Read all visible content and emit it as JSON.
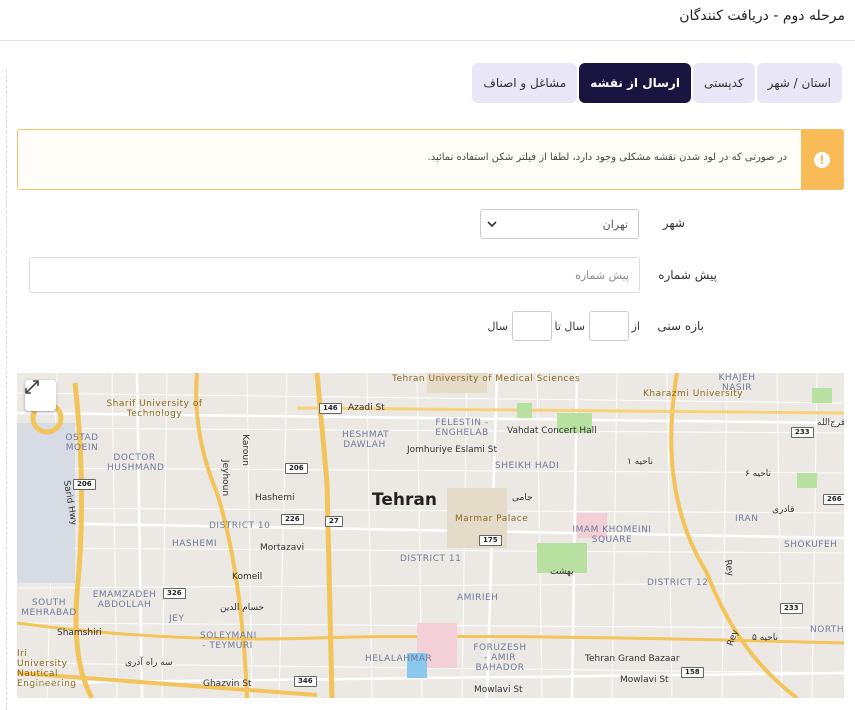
{
  "page": {
    "title": "مرحله دوم - دریافت کنندگان"
  },
  "tabs": [
    {
      "label": "استان / شهر",
      "active": false
    },
    {
      "label": "کدپستی",
      "active": false
    },
    {
      "label": "ارسال از نقشه",
      "active": true
    },
    {
      "label": "مشاغل و اصناف",
      "active": false
    }
  ],
  "alert": {
    "icon": "exclamation-icon",
    "text": "در صورتی که در لود شدن نقشه مشکلی وجود دارد، لطفا از فیلتر شکن استفاده نمائید."
  },
  "form": {
    "city_label": "شهر",
    "city_value": "تهران",
    "prefix_label": "پیش شماره",
    "prefix_placeholder": "پیش شماره",
    "age_label": "بازه سنی",
    "age_from": "از",
    "age_year_to": "سال تا",
    "age_year": "سال"
  },
  "map": {
    "city": "Tehran",
    "labels": {
      "l1": "Tehran University of Medical Sciences",
      "l2": "Sharif University of Technology",
      "l3": "Azadi St",
      "l4": "Kharazmi University",
      "l5": "KHAJEH NASIR",
      "l6": "OSTAD MOEIN",
      "l7": "HESHMAT DAWLAH",
      "l8": "FELESTIN - ENGHELAB",
      "l9": "Vahdat Concert Hall",
      "l10": "Jomhuriye Eslami St",
      "l11": "DOCTOR HUSHMAND",
      "l12": "SHEIKH HADI",
      "l13": "Karoun",
      "l14": "Jeyhoun",
      "l15": "Hashemi",
      "l16": "Sarid Hwy",
      "l17": "DISTRICT 10",
      "l18": "Marmar Palace",
      "l19": "IMAM KHOMEINI SQUARE",
      "l20": "IRAN",
      "l21": "SHOKUFEH",
      "l22": "HASHEMI",
      "l23": "Mortazavi",
      "l24": "DISTRICT 11",
      "l25": "Komeil",
      "l26": "EMAMZADEH ABDOLLAH",
      "l27": "SOUTH MEHRABAD",
      "l28": "DISTRICT 12",
      "l29": "JEY",
      "l30": "AMIRIEH",
      "l31": "Shamshiri",
      "l32": "SOLEYMANI - TEYMURI",
      "l33": "NORTH",
      "l34": "Iri University Nautical Engineering",
      "l35": "HELALAHMAR",
      "l36": "FORUZESH - AMIR BAHADOR",
      "l37": "Tehran Grand Bazaar",
      "l38": "Ghazvin St",
      "l39": "Mowlavi St",
      "l40": "Rey",
      "l41": "جامی",
      "l42": "بهشت",
      "l43": "حسام الدین",
      "l44": "سه راه آذری",
      "l45": "ناحیه ۱",
      "l46": "ناحیه ۶",
      "l47": "ناحیه ۵",
      "l48": "قادری",
      "l49": "فرج‌الله"
    },
    "shields": {
      "s1": "146",
      "s2": "206",
      "s3": "226",
      "s4": "27",
      "s5": "175",
      "s6": "326",
      "s7": "346",
      "s8": "158",
      "s9": "233",
      "s10": "266",
      "s11": "233",
      "s12": "206"
    }
  }
}
